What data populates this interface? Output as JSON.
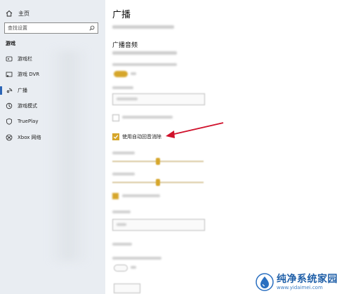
{
  "sidebar": {
    "home_label": "主页",
    "search_placeholder": "查找设置",
    "section_title": "游戏",
    "items": [
      {
        "label": "游戏栏",
        "icon": "game-bar-icon"
      },
      {
        "label": "游戏 DVR",
        "icon": "dvr-icon"
      },
      {
        "label": "广播",
        "icon": "broadcast-icon",
        "active": true
      },
      {
        "label": "游戏模式",
        "icon": "game-mode-icon"
      },
      {
        "label": "TruePlay",
        "icon": "trueplay-icon"
      },
      {
        "label": "Xbox 网络",
        "icon": "xbox-icon"
      }
    ]
  },
  "main": {
    "page_title": "广播",
    "section_audio": "广播音频",
    "echo_cancel_label": "使用自动回音消除"
  },
  "watermark": {
    "title": "纯净系统家园",
    "url": "www.yidaimei.com"
  },
  "colors": {
    "accent": "#d6a62b",
    "arrow": "#d0112b",
    "nav_active": "#2b64b5"
  }
}
